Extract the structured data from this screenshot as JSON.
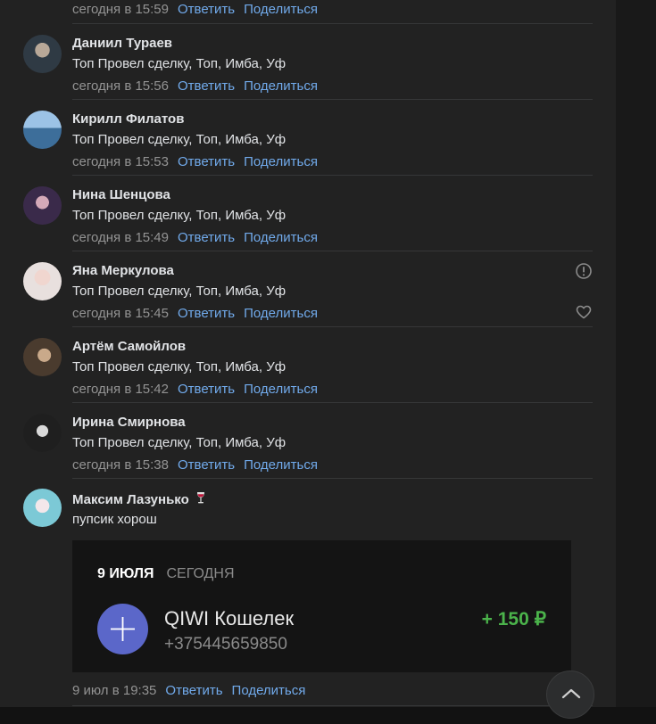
{
  "actions": {
    "reply": "Ответить",
    "share": "Поделиться"
  },
  "top_item": {
    "time": "сегодня в 15:59"
  },
  "comments": [
    {
      "name": "Даниил Тураев",
      "text": "Топ Провел сделку, Топ, Имба, Уф",
      "time": "сегодня в 15:56"
    },
    {
      "name": "Кирилл Филатов",
      "text": "Топ Провел сделку, Топ, Имба, Уф",
      "time": "сегодня в 15:53"
    },
    {
      "name": "Нина Шенцова",
      "text": "Топ Провел сделку, Топ, Имба, Уф",
      "time": "сегодня в 15:49"
    },
    {
      "name": "Яна Меркулова",
      "text": "Топ Провел сделку, Топ, Имба, Уф",
      "time": "сегодня в 15:45"
    },
    {
      "name": "Артём Самойлов",
      "text": "Топ Провел сделку, Топ, Имба, Уф",
      "time": "сегодня в 15:42"
    },
    {
      "name": "Ирина Смирнова",
      "text": "Топ Провел сделку, Топ, Имба, Уф",
      "time": "сегодня в 15:38"
    }
  ],
  "last_comment": {
    "name": "Максим Лазунько",
    "emoji_icon": "wine-glass-icon",
    "text": "пупсик хорош",
    "time": "9 июл в 19:35",
    "attachment": {
      "tab_active": "9 ИЮЛЯ",
      "tab_other": "СЕГОДНЯ",
      "title": "QIWI Кошелек",
      "phone": "+375445659850",
      "amount": "+ 150 ₽",
      "icon": "plus-icon"
    }
  },
  "icons": {
    "report": "exclamation-circle-icon",
    "like": "heart-icon",
    "scroll_top": "chevron-up-icon"
  },
  "colors": {
    "link": "#71aaeb",
    "amount": "#4bb34b",
    "qiwi_circle": "#5b67c9",
    "panel": "#222222"
  }
}
